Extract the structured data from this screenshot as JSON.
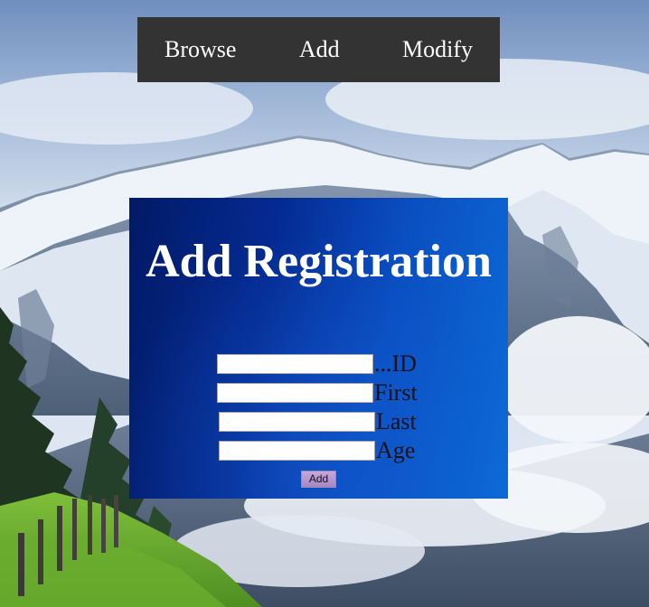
{
  "nav": {
    "items": [
      {
        "label": "Browse"
      },
      {
        "label": "Add"
      },
      {
        "label": "Modify"
      }
    ]
  },
  "form": {
    "title": "Add Registration",
    "fields": [
      {
        "label": "...ID",
        "value": ""
      },
      {
        "label": "First",
        "value": ""
      },
      {
        "label": "Last",
        "value": ""
      },
      {
        "label": "Age",
        "value": ""
      }
    ],
    "submit_label": "Add"
  },
  "colors": {
    "nav_background": "#333333",
    "panel_dark": "#021a66",
    "panel_light": "#0d6ad6",
    "button": "#b495cc"
  }
}
